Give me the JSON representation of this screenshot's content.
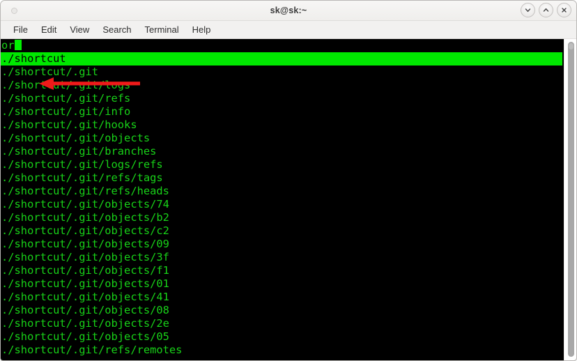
{
  "window": {
    "title": "sk@sk:~",
    "controls": [
      {
        "name": "minimize-button",
        "glyph": "chevron-down"
      },
      {
        "name": "maximize-button",
        "glyph": "chevron-up"
      },
      {
        "name": "close-button",
        "glyph": "x"
      }
    ]
  },
  "menubar": {
    "items": [
      {
        "label": "File"
      },
      {
        "label": "Edit"
      },
      {
        "label": "View"
      },
      {
        "label": "Search"
      },
      {
        "label": "Terminal"
      },
      {
        "label": "Help"
      }
    ]
  },
  "terminal": {
    "prompt_line": "or",
    "cursor": "block",
    "selected_index": 1,
    "lines": [
      "./shortcut",
      "./shortcut/.git",
      "./shortcut/.git/logs",
      "./shortcut/.git/refs",
      "./shortcut/.git/info",
      "./shortcut/.git/hooks",
      "./shortcut/.git/objects",
      "./shortcut/.git/branches",
      "./shortcut/.git/logs/refs",
      "./shortcut/.git/refs/tags",
      "./shortcut/.git/refs/heads",
      "./shortcut/.git/objects/74",
      "./shortcut/.git/objects/b2",
      "./shortcut/.git/objects/c2",
      "./shortcut/.git/objects/09",
      "./shortcut/.git/objects/3f",
      "./shortcut/.git/objects/f1",
      "./shortcut/.git/objects/01",
      "./shortcut/.git/objects/41",
      "./shortcut/.git/objects/08",
      "./shortcut/.git/objects/2e",
      "./shortcut/.git/objects/05",
      "./shortcut/.git/refs/remotes"
    ],
    "colors": {
      "background": "#000000",
      "foreground": "#18d218",
      "selection_background": "#00e800",
      "selection_foreground": "#000000",
      "cursor": "#00f000"
    }
  },
  "annotation": {
    "arrow_color": "#f01a1a",
    "arrow_direction": "left"
  },
  "scrollbar": {
    "orientation": "vertical",
    "thumb_color": "#a8a8a8"
  }
}
